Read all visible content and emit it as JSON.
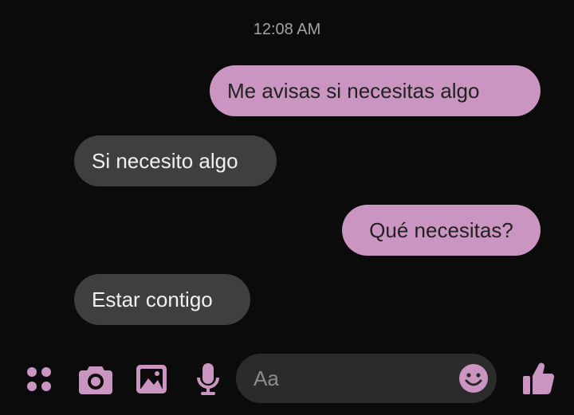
{
  "conversation": {
    "timestamp": "12:08 AM",
    "messages": [
      {
        "direction": "outgoing",
        "text": "Me avisas si necesitas algo"
      },
      {
        "direction": "incoming",
        "text": "Si necesito algo"
      },
      {
        "direction": "outgoing",
        "text": "Qué necesitas?"
      },
      {
        "direction": "incoming",
        "text": "Estar contigo"
      }
    ]
  },
  "composer": {
    "placeholder": "Aa",
    "icons": [
      "more-apps-icon",
      "camera-icon",
      "gallery-icon",
      "microphone-icon",
      "emoji-icon",
      "thumbs-up-icon"
    ]
  },
  "colors": {
    "accent": "#cb95c2",
    "outgoing_bubble": "#cb95c2",
    "incoming_bubble": "#3f3f3f",
    "background": "#0b0b0b"
  }
}
